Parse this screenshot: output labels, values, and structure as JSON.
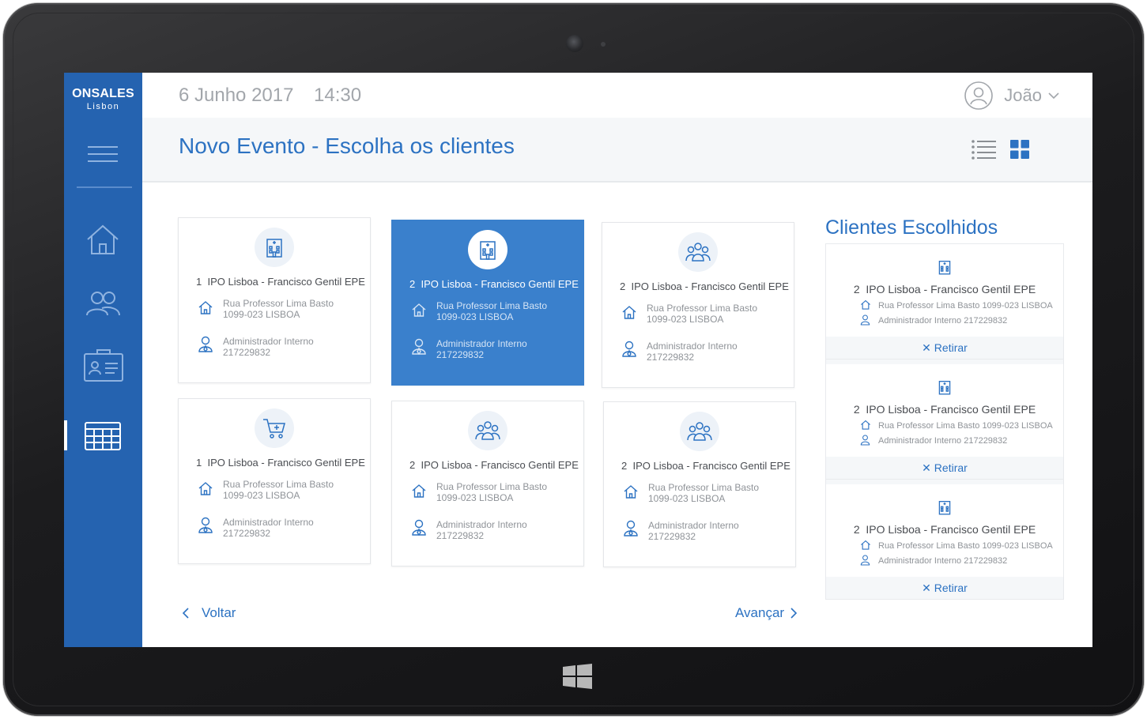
{
  "brand": {
    "name": "ONSALES",
    "city": "Lisbon"
  },
  "topbar": {
    "date": "6 Junho 2017",
    "time": "14:30",
    "user_name": "João"
  },
  "header": {
    "title": "Novo Evento - Escolha os clientes"
  },
  "sidebar": {
    "items": [
      {
        "icon": "home-icon",
        "active": false
      },
      {
        "icon": "people-icon",
        "active": false
      },
      {
        "icon": "contact-card-icon",
        "active": false
      },
      {
        "icon": "calendar-icon",
        "active": true
      }
    ]
  },
  "cards": [
    {
      "num": "1",
      "name": "IPO Lisboa - Francisco Gentil EPE",
      "address1": "Rua Professor Lima Basto",
      "address2": "1099-023 LISBOA",
      "role": "Administrador Interno",
      "phone": "217229832",
      "icon": "hospital-icon",
      "selected": false
    },
    {
      "num": "2",
      "name": "IPO Lisboa - Francisco Gentil EPE",
      "address1": "Rua Professor Lima Basto",
      "address2": "1099-023 LISBOA",
      "role": "Administrador Interno",
      "phone": "217229832",
      "icon": "hospital-icon",
      "selected": true
    },
    {
      "num": "2",
      "name": "IPO Lisboa - Francisco Gentil EPE",
      "address1": "Rua Professor Lima Basto",
      "address2": "1099-023 LISBOA",
      "role": "Administrador Interno",
      "phone": "217229832",
      "icon": "group-icon",
      "selected": false
    },
    {
      "num": "1",
      "name": "IPO Lisboa - Francisco Gentil EPE",
      "address1": "Rua Professor Lima Basto",
      "address2": "1099-023 LISBOA",
      "role": "Administrador Interno",
      "phone": "217229832",
      "icon": "cart-icon",
      "selected": false
    },
    {
      "num": "2",
      "name": "IPO Lisboa - Francisco Gentil EPE",
      "address1": "Rua Professor Lima Basto",
      "address2": "1099-023 LISBOA",
      "role": "Administrador Interno",
      "phone": "217229832",
      "icon": "group-icon",
      "selected": false
    },
    {
      "num": "2",
      "name": "IPO Lisboa - Francisco Gentil EPE",
      "address1": "Rua Professor Lima Basto",
      "address2": "1099-023 LISBOA",
      "role": "Administrador Interno",
      "phone": "217229832",
      "icon": "group-icon",
      "selected": false
    }
  ],
  "nav": {
    "back": "Voltar",
    "next": "Avançar"
  },
  "chosen": {
    "title": "Clientes Escolhidos",
    "remove_label": "Retirar",
    "items": [
      {
        "num": "2",
        "name": "IPO Lisboa - Francisco Gentil EPE",
        "address": "Rua Professor Lima Basto 1099-023 LISBOA",
        "contact": "Administrador Interno 217229832"
      },
      {
        "num": "2",
        "name": "IPO Lisboa - Francisco Gentil EPE",
        "address": "Rua Professor Lima Basto 1099-023 LISBOA",
        "contact": "Administrador Interno 217229832"
      },
      {
        "num": "2",
        "name": "IPO Lisboa - Francisco Gentil EPE",
        "address": "Rua Professor Lima Basto 1099-023 LISBOA",
        "contact": "Administrador Interno 217229832"
      }
    ]
  },
  "colors": {
    "sidebar": "#2563b0",
    "accent": "#2c72c2",
    "selected_card": "#3a80cc",
    "muted_text": "#a2a6ab"
  }
}
